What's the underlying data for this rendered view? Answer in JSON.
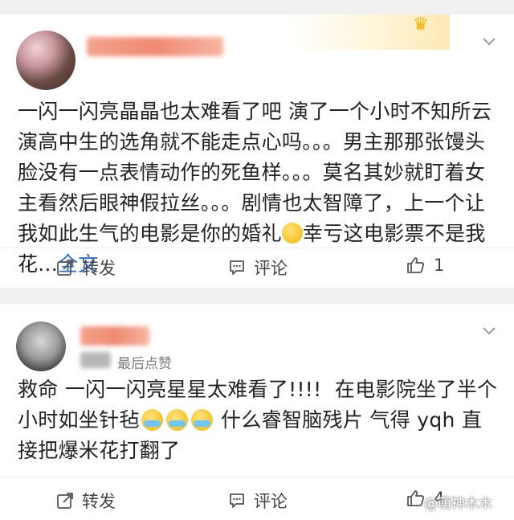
{
  "posts": [
    {
      "content_main": "一闪一闪亮晶晶也太难看了吧 演了一个小时不知所云演高中生的选角就不能走点心吗。。。男主那那张馒头脸没有一点表情动作的死鱼样。。。莫名其妙就盯着女主看然后眼神假拉丝。。。剧情也太智障了，上一个让我如此生气的电影是你的婚礼",
      "content_after_emoji": "幸亏这电影票不是我花...",
      "full_text_link": "全文",
      "actions": {
        "repost": "转发",
        "comment": "评论",
        "like_count": "1"
      }
    },
    {
      "meta_text": "最后点赞",
      "content_main": "救命 一闪一闪亮星星太难看了!!!!  在电影院坐了半个小时如坐针毡",
      "content_after_emoji": " 什么睿智脑残片 气得 yqh 直接把爆米花打翻了",
      "actions": {
        "repost": "转发",
        "comment": "评论",
        "like_count": "4"
      }
    }
  ],
  "watermark": "@萌神木木",
  "icons": {
    "crown": "crown-icon",
    "chevron": "chevron-down-icon",
    "repost": "repost-icon",
    "comment": "comment-icon",
    "like": "thumbs-up-icon"
  },
  "colors": {
    "link": "#2d6ec9",
    "background": "#f0f0f0",
    "card": "#ffffff"
  }
}
